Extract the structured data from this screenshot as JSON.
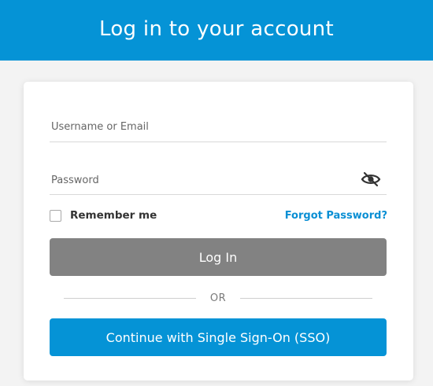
{
  "header": {
    "title": "Log in to your account"
  },
  "form": {
    "username_placeholder": "Username or Email",
    "username_value": "",
    "password_placeholder": "Password",
    "password_value": "",
    "password_toggle_icon": "eye-hidden-icon",
    "remember_label": "Remember me",
    "remember_checked": false,
    "forgot_label": "Forgot Password?",
    "login_label": "Log In",
    "divider_label": "OR",
    "sso_label": "Continue with Single Sign-On (SSO)"
  },
  "colors": {
    "brand_blue": "#0593d6",
    "link_blue": "#0a8fd4",
    "disabled_button": "#828282"
  }
}
